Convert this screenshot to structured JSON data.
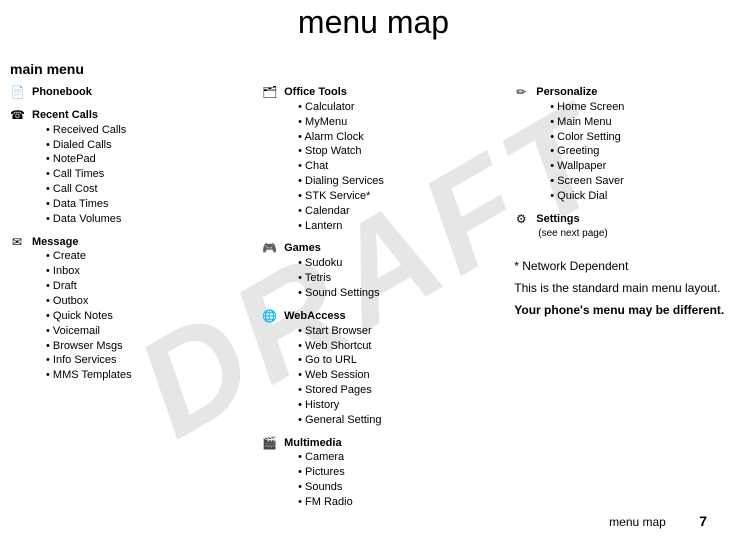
{
  "watermark": "DRAFT",
  "page_title": "menu map",
  "main_menu_label": "main menu",
  "columns": {
    "col1": {
      "phonebook": {
        "title": "Phonebook"
      },
      "recent_calls": {
        "title": "Recent Calls",
        "items": [
          "Received Calls",
          "Dialed Calls",
          "NotePad",
          "Call Times",
          "Call Cost",
          "Data Times",
          "Data Volumes"
        ]
      },
      "message": {
        "title": "Message",
        "items": [
          "Create",
          "Inbox",
          "Draft",
          "Outbox",
          "Quick Notes",
          "Voicemail",
          "Browser Msgs",
          "Info Services",
          "MMS Templates"
        ]
      }
    },
    "col2": {
      "office_tools": {
        "title": "Office Tools",
        "items": [
          "Calculator",
          "MyMenu",
          "Alarm Clock",
          "Stop Watch",
          "Chat",
          "Dialing Services",
          "STK Service*",
          "Calendar",
          "Lantern"
        ]
      },
      "games": {
        "title": "Games",
        "items": [
          "Sudoku",
          "Tetris",
          "Sound Settings"
        ]
      },
      "webaccess": {
        "title": "WebAccess",
        "items": [
          "Start Browser",
          "Web Shortcut",
          "Go to URL",
          "Web Session",
          "Stored Pages",
          "History",
          "General Setting"
        ]
      },
      "multimedia": {
        "title": "Multimedia",
        "items": [
          "Camera",
          "Pictures",
          "Sounds",
          "FM Radio"
        ]
      }
    },
    "col3": {
      "personalize": {
        "title": "Personalize",
        "items": [
          "Home Screen",
          "Main Menu",
          "Color Setting",
          "Greeting",
          "Wallpaper",
          "Screen Saver",
          "Quick Dial"
        ]
      },
      "settings": {
        "title": "Settings",
        "sub": "(see next page)"
      },
      "note_asterisk": "* Network Dependent",
      "note_line1": "This is the standard main menu layout.",
      "note_line2": "Your phone's menu may be different."
    }
  },
  "footer": {
    "label": "menu map",
    "page": "7"
  }
}
